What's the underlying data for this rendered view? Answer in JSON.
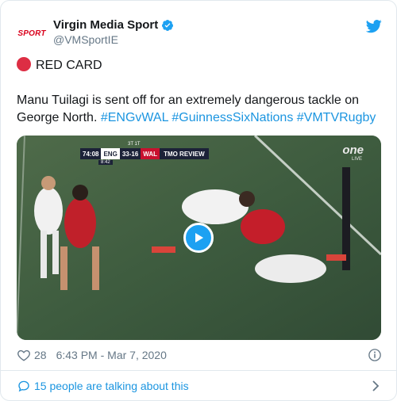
{
  "account": {
    "avatar_text": "SPORT",
    "name": "Virgin Media Sport",
    "handle": "@VMSportIE"
  },
  "tweet": {
    "label": "RED CARD",
    "text_plain": "Manu Tuilagi is sent off for an extremely dangerous tackle on",
    "text_line2_plain": "George North. ",
    "hashtags": [
      "#ENGvWAL",
      "#GuinnessSixNations",
      "#VMTVRugby"
    ]
  },
  "video": {
    "scoreboard": {
      "time": "74:08",
      "home": "ENG",
      "score": "33-16",
      "away": "WAL",
      "status": "TMO REVIEW",
      "top_labels": "3T   1T",
      "clock": "8:42"
    },
    "broadcaster": "one",
    "broadcaster_sub": "LIVE"
  },
  "footer": {
    "likes": "28",
    "timestamp": "6:43 PM - Mar 7, 2020"
  },
  "conversation": {
    "label": "15 people are talking about this"
  },
  "colors": {
    "accent": "#1da1f2",
    "link": "#1b95e0",
    "red_card": "#dd2e44",
    "muted": "#657786"
  }
}
